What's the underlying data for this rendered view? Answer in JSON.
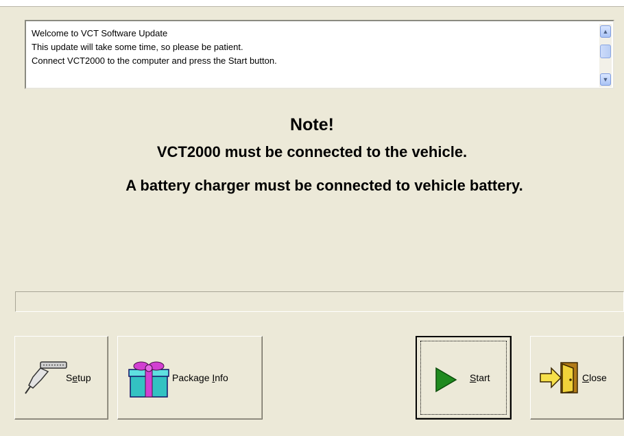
{
  "log": {
    "lines": [
      "Welcome to VCT Software Update",
      "This update will take some time, so please be patient.",
      "Connect VCT2000 to the computer and press the Start button."
    ]
  },
  "note": {
    "title": "Note!",
    "line1": "VCT2000 must be connected to the vehicle.",
    "line2": "A battery charger must be connected to vehicle battery."
  },
  "progress": {
    "value": 0
  },
  "buttons": {
    "setup": {
      "pre": "S",
      "accel": "e",
      "post": "tup",
      "icon": "cable-icon"
    },
    "package_info": {
      "pre": "Package ",
      "accel": "I",
      "post": "nfo",
      "icon": "gift-icon"
    },
    "start": {
      "pre": "",
      "accel": "S",
      "post": "tart",
      "icon": "play-icon",
      "color": "#1f8a1f"
    },
    "close": {
      "pre": "",
      "accel": "C",
      "post": "lose",
      "icon": "exit-door-icon"
    }
  }
}
